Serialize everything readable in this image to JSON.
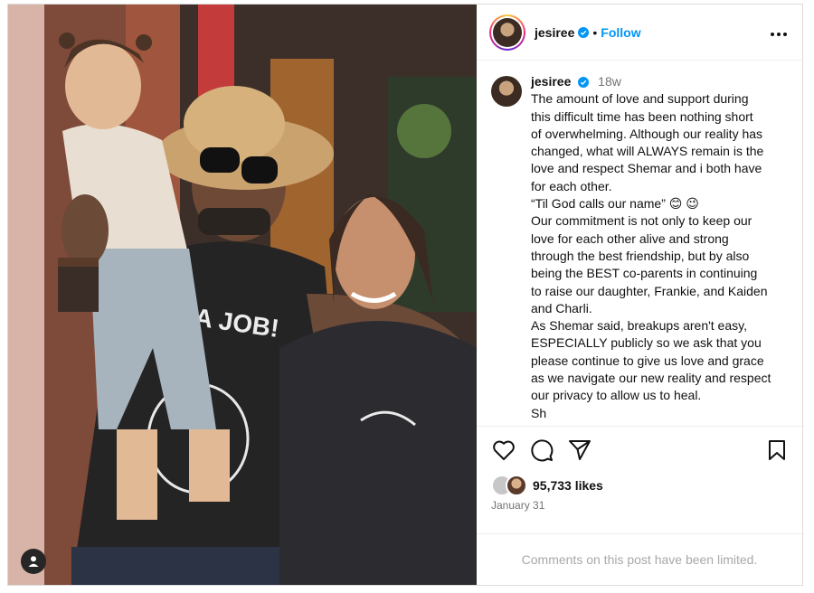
{
  "post": {
    "username": "jesiree",
    "follow_label": "Follow",
    "dot": "•",
    "time_ago": "18w",
    "caption_lines": [
      "The amount of love and support during",
      "this difficult time has been nothing short",
      "of overwhelming. Although our reality has",
      "changed, what will ALWAYS remain is the",
      "love and respect Shemar and i both have",
      "for each other.",
      "“Til God calls our name” 😊 😉",
      "Our commitment is not only to keep our",
      "love for each other alive and strong",
      "through the best friendship, but by also",
      "being the BEST co-parents in continuing",
      "to raise our daughter, Frankie, and Kaiden",
      "and Charli.",
      "As Shemar said, breakups aren't easy,",
      "ESPECIALLY publicly so we ask that you",
      "please continue to give us love and grace",
      "as we navigate our new reality and respect",
      "our privacy to allow us to heal.",
      "",
      "Sh"
    ],
    "likes": "95,733 likes",
    "date": "January 31",
    "comments_limited": "Comments on this post have been limited.",
    "photo_shirt_text": "A JOB!"
  },
  "icons": {
    "verified": "verified-badge-icon",
    "more": "more-options-icon",
    "like": "heart-icon",
    "comment": "comment-icon",
    "share": "share-icon",
    "save": "bookmark-icon",
    "tagged": "user-tag-icon"
  },
  "colors": {
    "accent": "#0095f6",
    "secondary_text": "#737373",
    "muted_text": "#a8a8a8",
    "divider": "#efefef"
  }
}
